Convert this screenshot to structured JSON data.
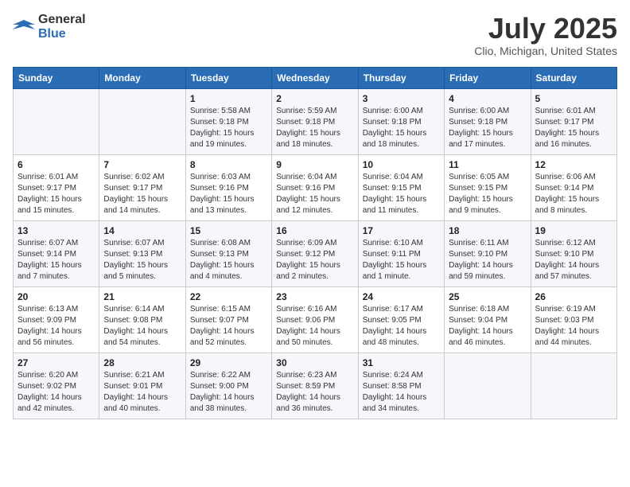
{
  "header": {
    "logo_line1": "General",
    "logo_line2": "Blue",
    "month": "July 2025",
    "location": "Clio, Michigan, United States"
  },
  "days_of_week": [
    "Sunday",
    "Monday",
    "Tuesday",
    "Wednesday",
    "Thursday",
    "Friday",
    "Saturday"
  ],
  "weeks": [
    [
      {
        "day": "",
        "info": ""
      },
      {
        "day": "",
        "info": ""
      },
      {
        "day": "1",
        "info": "Sunrise: 5:58 AM\nSunset: 9:18 PM\nDaylight: 15 hours and 19 minutes."
      },
      {
        "day": "2",
        "info": "Sunrise: 5:59 AM\nSunset: 9:18 PM\nDaylight: 15 hours and 18 minutes."
      },
      {
        "day": "3",
        "info": "Sunrise: 6:00 AM\nSunset: 9:18 PM\nDaylight: 15 hours and 18 minutes."
      },
      {
        "day": "4",
        "info": "Sunrise: 6:00 AM\nSunset: 9:18 PM\nDaylight: 15 hours and 17 minutes."
      },
      {
        "day": "5",
        "info": "Sunrise: 6:01 AM\nSunset: 9:17 PM\nDaylight: 15 hours and 16 minutes."
      }
    ],
    [
      {
        "day": "6",
        "info": "Sunrise: 6:01 AM\nSunset: 9:17 PM\nDaylight: 15 hours and 15 minutes."
      },
      {
        "day": "7",
        "info": "Sunrise: 6:02 AM\nSunset: 9:17 PM\nDaylight: 15 hours and 14 minutes."
      },
      {
        "day": "8",
        "info": "Sunrise: 6:03 AM\nSunset: 9:16 PM\nDaylight: 15 hours and 13 minutes."
      },
      {
        "day": "9",
        "info": "Sunrise: 6:04 AM\nSunset: 9:16 PM\nDaylight: 15 hours and 12 minutes."
      },
      {
        "day": "10",
        "info": "Sunrise: 6:04 AM\nSunset: 9:15 PM\nDaylight: 15 hours and 11 minutes."
      },
      {
        "day": "11",
        "info": "Sunrise: 6:05 AM\nSunset: 9:15 PM\nDaylight: 15 hours and 9 minutes."
      },
      {
        "day": "12",
        "info": "Sunrise: 6:06 AM\nSunset: 9:14 PM\nDaylight: 15 hours and 8 minutes."
      }
    ],
    [
      {
        "day": "13",
        "info": "Sunrise: 6:07 AM\nSunset: 9:14 PM\nDaylight: 15 hours and 7 minutes."
      },
      {
        "day": "14",
        "info": "Sunrise: 6:07 AM\nSunset: 9:13 PM\nDaylight: 15 hours and 5 minutes."
      },
      {
        "day": "15",
        "info": "Sunrise: 6:08 AM\nSunset: 9:13 PM\nDaylight: 15 hours and 4 minutes."
      },
      {
        "day": "16",
        "info": "Sunrise: 6:09 AM\nSunset: 9:12 PM\nDaylight: 15 hours and 2 minutes."
      },
      {
        "day": "17",
        "info": "Sunrise: 6:10 AM\nSunset: 9:11 PM\nDaylight: 15 hours and 1 minute."
      },
      {
        "day": "18",
        "info": "Sunrise: 6:11 AM\nSunset: 9:10 PM\nDaylight: 14 hours and 59 minutes."
      },
      {
        "day": "19",
        "info": "Sunrise: 6:12 AM\nSunset: 9:10 PM\nDaylight: 14 hours and 57 minutes."
      }
    ],
    [
      {
        "day": "20",
        "info": "Sunrise: 6:13 AM\nSunset: 9:09 PM\nDaylight: 14 hours and 56 minutes."
      },
      {
        "day": "21",
        "info": "Sunrise: 6:14 AM\nSunset: 9:08 PM\nDaylight: 14 hours and 54 minutes."
      },
      {
        "day": "22",
        "info": "Sunrise: 6:15 AM\nSunset: 9:07 PM\nDaylight: 14 hours and 52 minutes."
      },
      {
        "day": "23",
        "info": "Sunrise: 6:16 AM\nSunset: 9:06 PM\nDaylight: 14 hours and 50 minutes."
      },
      {
        "day": "24",
        "info": "Sunrise: 6:17 AM\nSunset: 9:05 PM\nDaylight: 14 hours and 48 minutes."
      },
      {
        "day": "25",
        "info": "Sunrise: 6:18 AM\nSunset: 9:04 PM\nDaylight: 14 hours and 46 minutes."
      },
      {
        "day": "26",
        "info": "Sunrise: 6:19 AM\nSunset: 9:03 PM\nDaylight: 14 hours and 44 minutes."
      }
    ],
    [
      {
        "day": "27",
        "info": "Sunrise: 6:20 AM\nSunset: 9:02 PM\nDaylight: 14 hours and 42 minutes."
      },
      {
        "day": "28",
        "info": "Sunrise: 6:21 AM\nSunset: 9:01 PM\nDaylight: 14 hours and 40 minutes."
      },
      {
        "day": "29",
        "info": "Sunrise: 6:22 AM\nSunset: 9:00 PM\nDaylight: 14 hours and 38 minutes."
      },
      {
        "day": "30",
        "info": "Sunrise: 6:23 AM\nSunset: 8:59 PM\nDaylight: 14 hours and 36 minutes."
      },
      {
        "day": "31",
        "info": "Sunrise: 6:24 AM\nSunset: 8:58 PM\nDaylight: 14 hours and 34 minutes."
      },
      {
        "day": "",
        "info": ""
      },
      {
        "day": "",
        "info": ""
      }
    ]
  ]
}
